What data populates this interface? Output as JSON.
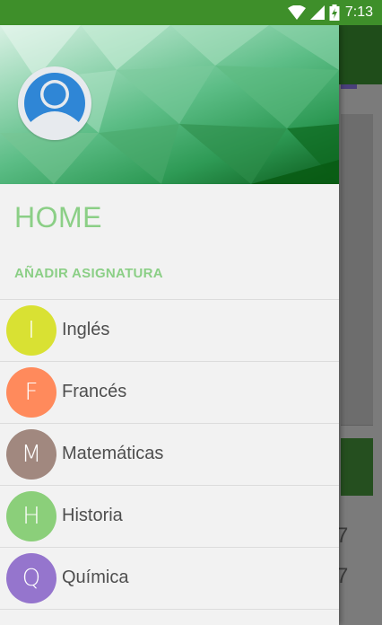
{
  "status_bar": {
    "time": "7:13",
    "icons": [
      "wifi-icon",
      "signal-icon",
      "battery-charging-icon"
    ],
    "color": "#3e8f2a"
  },
  "drawer": {
    "header": {
      "avatar_icon": "user-avatar-icon"
    },
    "title": "HOME",
    "add_subject_label": "AÑADIR ASIGNATURA",
    "accent_color": "#8bcf86",
    "subjects": [
      {
        "letter": "I",
        "name": "Inglés",
        "color": "#d9e133"
      },
      {
        "letter": "F",
        "name": "Francés",
        "color": "#ff8a5c"
      },
      {
        "letter": "M",
        "name": "Matemáticas",
        "color": "#a1887f"
      },
      {
        "letter": "H",
        "name": "Historia",
        "color": "#8bcf7a"
      },
      {
        "letter": "Q",
        "name": "Química",
        "color": "#9575cd"
      }
    ]
  },
  "background": {
    "numbers": [
      "7",
      "7"
    ]
  }
}
